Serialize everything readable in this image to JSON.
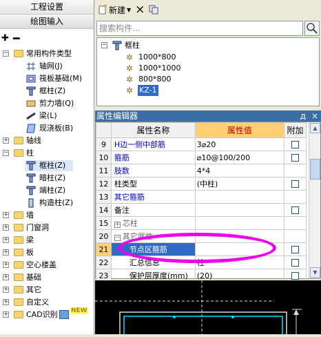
{
  "nav": {
    "btn1": "工程设置",
    "btn2": "绘图输入"
  },
  "tree": {
    "root": "常用构件类型",
    "common_items": [
      "轴网(J)",
      "筏板基础(M)",
      "框柱(Z)",
      "剪力墙(Q)",
      "梁(L)",
      "现浇板(B)"
    ],
    "axis_group": "轴线",
    "column_group": "柱",
    "column_items": [
      "框柱(Z)",
      "暗柱(Z)",
      "端柱(Z)",
      "构造柱(Z)"
    ],
    "other_groups": [
      "墙",
      "门窗洞",
      "梁",
      "板",
      "空心楼盖",
      "基础",
      "其它",
      "自定义"
    ],
    "cad": "CAD识别",
    "new_badge": "NEW"
  },
  "toolbar": {
    "new_label": "新建",
    "delete": "×"
  },
  "search": {
    "placeholder": "搜索构件..."
  },
  "components": {
    "category": "框柱",
    "items": [
      "1000*800",
      "1000*1000",
      "800*800",
      "KZ-1"
    ]
  },
  "property_editor": {
    "title": "属性编辑器",
    "pin": "д",
    "close": "×",
    "headers": [
      "属性名称",
      "属性值",
      "附加"
    ],
    "rows": [
      {
        "num": "9",
        "name": "H边一侧中部筋",
        "value": "3⌀20"
      },
      {
        "num": "10",
        "name": "箍筋",
        "value": "⌀10@100/200"
      },
      {
        "num": "11",
        "name": "肢数",
        "value": "4*4"
      },
      {
        "num": "12",
        "name": "柱类型",
        "value": "(中柱)"
      },
      {
        "num": "13",
        "name": "其它箍筋",
        "value": ""
      },
      {
        "num": "14",
        "name": "备注",
        "value": ""
      },
      {
        "num": "15",
        "name": "芯柱",
        "value": ""
      },
      {
        "num": "20",
        "name": "其它属性",
        "value": ""
      },
      {
        "num": "21",
        "name": "节点区箍筋",
        "value": ""
      },
      {
        "num": "22",
        "name": "汇总信息",
        "value": "柱"
      },
      {
        "num": "23",
        "name": "保护层厚度(mm)",
        "value": "(20)"
      }
    ]
  },
  "colors": {
    "highlight": "#ffcf73",
    "annotation": "#ee00ee",
    "title_bar": "#3a6ea5"
  }
}
